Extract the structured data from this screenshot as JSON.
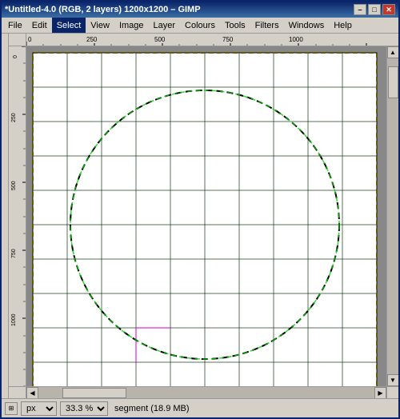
{
  "titleBar": {
    "title": "*Untitled-4.0 (RGB, 2 layers) 1200x1200 – GIMP",
    "minLabel": "–",
    "maxLabel": "□",
    "closeLabel": "✕"
  },
  "menuBar": {
    "items": [
      "File",
      "Edit",
      "Select",
      "View",
      "Image",
      "Layer",
      "Colours",
      "Tools",
      "Filters",
      "Windows",
      "Help"
    ]
  },
  "statusBar": {
    "unit": "px",
    "zoom": "33.3 %",
    "segment": "segment (18.9 MB)"
  },
  "ruler": {
    "topLabels": [
      "0",
      "250",
      "500",
      "750",
      "1000"
    ],
    "leftLabels": [
      "0",
      "250",
      "500",
      "750",
      "1000"
    ]
  },
  "canvas": {
    "bgColor": "#ffffff",
    "gridColorH": "#00aa00",
    "gridColorV": "#00aa00",
    "gridColorH2": "#009900",
    "selectionColor": "#000000"
  }
}
